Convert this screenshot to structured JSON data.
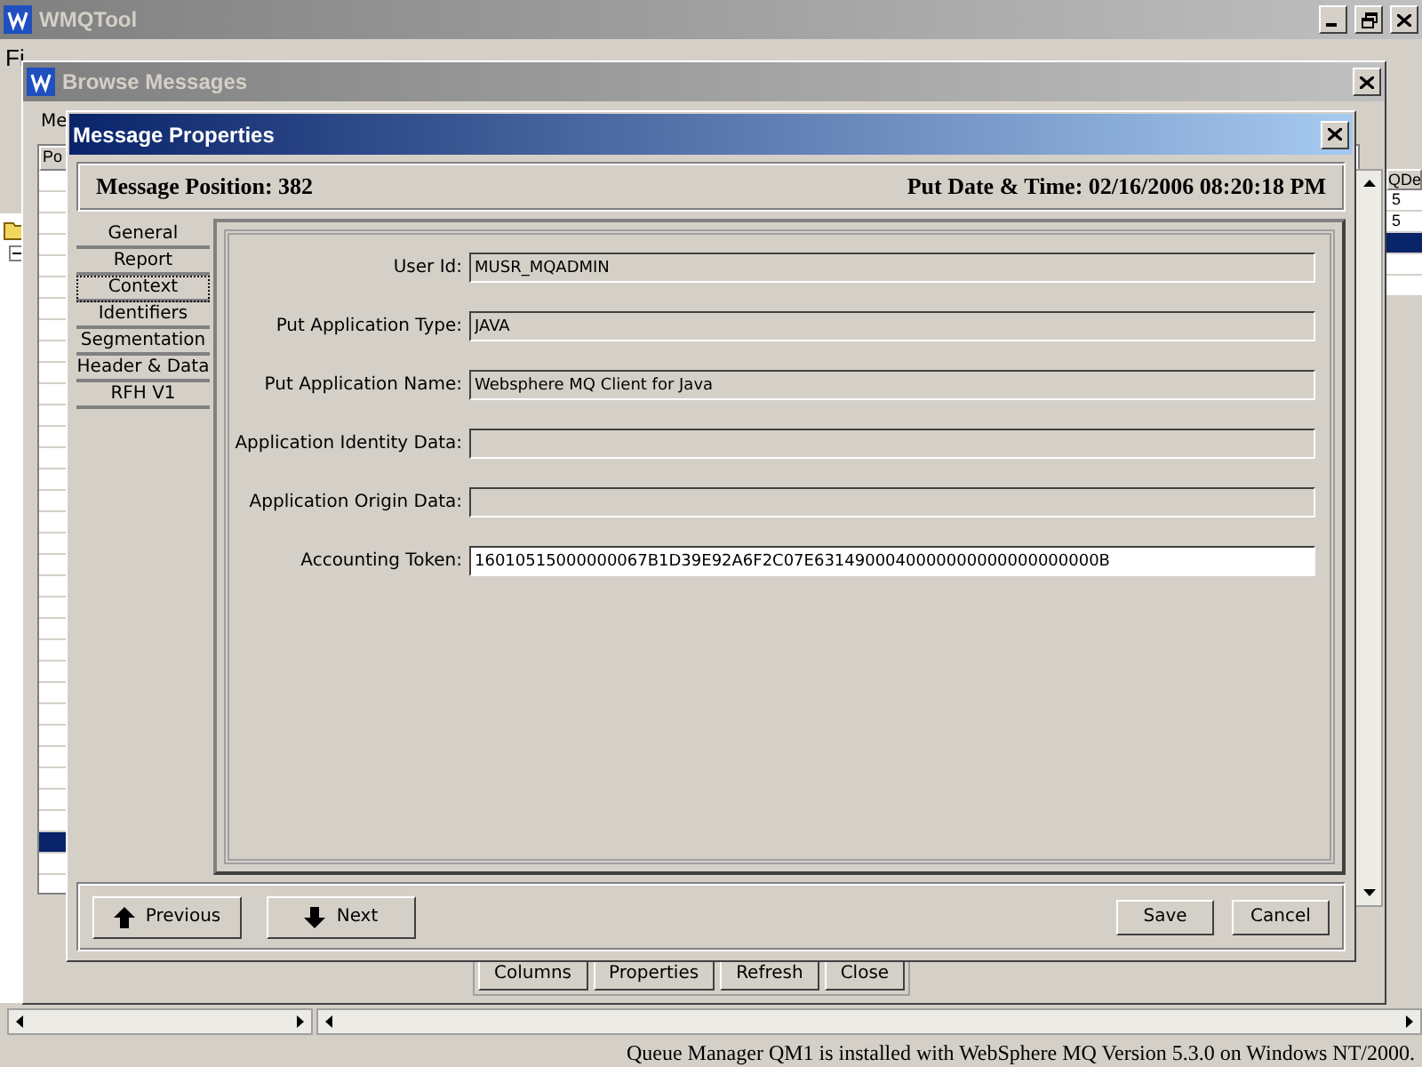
{
  "main_window": {
    "title": "WMQTool",
    "menu": [
      {
        "label": "Fi"
      }
    ],
    "table": {
      "column": "QDe",
      "rows": [
        {
          "cell": "5",
          "selected": false
        },
        {
          "cell": "5",
          "selected": false
        },
        {
          "selected": true
        },
        {
          "selected": false
        },
        {
          "selected": false
        }
      ]
    }
  },
  "browse_window": {
    "title": "Browse Messages",
    "label": "Me",
    "table": {
      "column": "Po",
      "rows": [
        {
          "selected": false
        },
        {
          "selected": false
        },
        {
          "selected": false
        },
        {
          "selected": false
        },
        {
          "selected": false
        },
        {
          "selected": false
        },
        {
          "selected": false
        },
        {
          "selected": false
        },
        {
          "selected": false
        },
        {
          "selected": false
        },
        {
          "selected": false
        },
        {
          "selected": false
        },
        {
          "selected": false
        },
        {
          "selected": false
        },
        {
          "selected": false
        },
        {
          "selected": false
        },
        {
          "selected": false
        },
        {
          "selected": false
        },
        {
          "selected": false
        },
        {
          "selected": false
        },
        {
          "selected": false
        },
        {
          "selected": false
        },
        {
          "selected": false
        },
        {
          "selected": false
        },
        {
          "selected": false
        },
        {
          "selected": false
        },
        {
          "selected": false
        },
        {
          "selected": false
        },
        {
          "selected": false
        },
        {
          "selected": false
        },
        {
          "selected": false
        },
        {
          "selected": true
        },
        {
          "selected": false
        }
      ]
    },
    "buttons": [
      "Columns",
      "Properties",
      "Refresh",
      "Close"
    ]
  },
  "dialog": {
    "title": "Message Properties",
    "position": "Message Position: 382",
    "put_date_time": "Put Date & Time: 02/16/2006 08:20:18 PM",
    "tabs": [
      {
        "label": "General",
        "selected": false
      },
      {
        "label": "Report",
        "selected": false
      },
      {
        "label": "Context",
        "selected": true
      },
      {
        "label": "Identifiers",
        "selected": false
      },
      {
        "label": "Segmentation",
        "selected": false
      },
      {
        "label": "Header & Data",
        "selected": false
      },
      {
        "label": "RFH V1",
        "selected": false
      }
    ],
    "fields": [
      {
        "label": "User Id:",
        "value": "MUSR_MQADMIN",
        "editable": false
      },
      {
        "label": "Put Application Type:",
        "value": "JAVA",
        "editable": false
      },
      {
        "label": "Put Application Name:",
        "value": "Websphere MQ Client for Java",
        "editable": false
      },
      {
        "label": "Application Identity Data:",
        "editable": false
      },
      {
        "label": "Application Origin Data:",
        "editable": false
      },
      {
        "label": "Accounting Token:",
        "value": "16010515000000067B1D39E92A6F2C07E6314900040000000000000000000B",
        "editable": true
      }
    ],
    "nav_buttons": [
      {
        "label": "Previous",
        "kind": "up"
      },
      {
        "label": "Next",
        "kind": "down"
      }
    ],
    "action_buttons": [
      "Save",
      "Cancel"
    ]
  },
  "status_bar": "Queue Manager QM1  is installed with WebSphere MQ Version 5.3.0 on Windows NT/2000."
}
